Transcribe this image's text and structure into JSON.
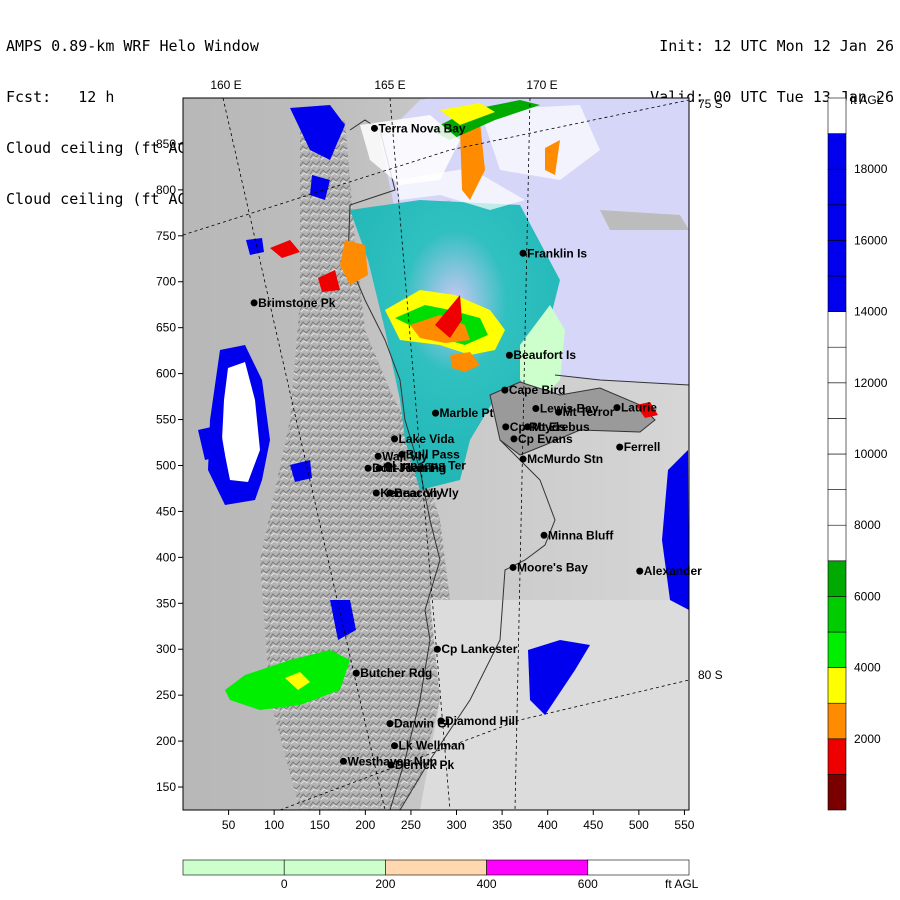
{
  "header": {
    "left": [
      "AMPS 0.89-km WRF Helo Window",
      "Fcst:   12 h",
      "Cloud ceiling (ft AGL)",
      "Cloud ceiling (ft AGL)"
    ],
    "right": [
      "Init: 12 UTC Mon 12 Jan 26",
      "Valid: 00 UTC Tue 13 Jan 26"
    ]
  },
  "map": {
    "lon_labels": [
      "160 E",
      "165 E",
      "170 E"
    ],
    "lat_labels": [
      "75 S",
      "80 S"
    ],
    "y_ticks": [
      150,
      200,
      250,
      300,
      350,
      400,
      450,
      500,
      550,
      600,
      650,
      700,
      750,
      800,
      850
    ],
    "x_ticks": [
      50,
      100,
      150,
      200,
      250,
      300,
      350,
      400,
      450,
      500,
      550
    ],
    "places": [
      {
        "name": "Terra Nova Bay",
        "x": 210,
        "y": 867
      },
      {
        "name": "Franklin Is",
        "x": 373,
        "y": 731
      },
      {
        "name": "Brimstone Pk",
        "x": 78,
        "y": 677
      },
      {
        "name": "Beaufort Is",
        "x": 358,
        "y": 620
      },
      {
        "name": "Cape Bird",
        "x": 353,
        "y": 582
      },
      {
        "name": "Lewis Bay",
        "x": 387,
        "y": 562
      },
      {
        "name": "Laurie",
        "x": 476,
        "y": 563
      },
      {
        "name": "Mt Terror",
        "x": 412,
        "y": 558
      },
      {
        "name": "Marble Pt",
        "x": 277,
        "y": 557
      },
      {
        "name": "Cp Royds",
        "x": 354,
        "y": 542
      },
      {
        "name": "Mt Erebus",
        "x": 378,
        "y": 542
      },
      {
        "name": "Lake Vida",
        "x": 232,
        "y": 529
      },
      {
        "name": "Cp Evans",
        "x": 363,
        "y": 529
      },
      {
        "name": "Ferrell",
        "x": 479,
        "y": 520
      },
      {
        "name": "Wall Vly",
        "x": 214,
        "y": 510
      },
      {
        "name": "Bull Pass",
        "x": 240,
        "y": 512
      },
      {
        "name": "McMurdo Stn",
        "x": 373,
        "y": 507
      },
      {
        "name": "Don Juan Pd",
        "x": 203,
        "y": 497
      },
      {
        "name": "Mt Fleming",
        "x": 215,
        "y": 497
      },
      {
        "name": "Linnaeus Ter",
        "x": 225,
        "y": 500
      },
      {
        "name": "Kennar Vly",
        "x": 212,
        "y": 470
      },
      {
        "name": "Beacon Vly",
        "x": 227,
        "y": 470
      },
      {
        "name": "Minna Bluff",
        "x": 396,
        "y": 424
      },
      {
        "name": "Moore's Bay",
        "x": 362,
        "y": 389
      },
      {
        "name": "Alexander",
        "x": 501,
        "y": 385
      },
      {
        "name": "Cp Lankester",
        "x": 279,
        "y": 300
      },
      {
        "name": "Butcher Rdg",
        "x": 190,
        "y": 274
      },
      {
        "name": "Darwin Gl",
        "x": 227,
        "y": 219
      },
      {
        "name": "Diamond Hill",
        "x": 283,
        "y": 222
      },
      {
        "name": "Lk Wellman",
        "x": 232,
        "y": 195
      },
      {
        "name": "Westhaven Nun",
        "x": 176,
        "y": 178
      },
      {
        "name": "Derrick Pk",
        "x": 228,
        "y": 174
      }
    ]
  },
  "colorbar_right": {
    "unit": "ft AGL",
    "labels": [
      "2000",
      "4000",
      "6000",
      "8000",
      "10000",
      "12000",
      "14000",
      "16000",
      "18000"
    ],
    "colors": [
      "#7a0000",
      "#ee0000",
      "#ff8c00",
      "#ffff00",
      "#00ee00",
      "#00cc00",
      "#00aa00",
      "#ffffff",
      "#ffffff",
      "#ffffff",
      "#ffffff",
      "#ffffff",
      "#ffffff",
      "#ffffff",
      "#0000ee",
      "#0000ee",
      "#0000ee",
      "#0000ee",
      "#0000ee",
      "#ffffff"
    ]
  },
  "colorbar_bottom": {
    "unit": "ft AGL",
    "labels": [
      "0",
      "200",
      "400",
      "600"
    ],
    "colors": [
      "#ccffcc",
      "#ccffcc",
      "#ffd8b0",
      "#ff00ff",
      "#ffffff"
    ]
  }
}
